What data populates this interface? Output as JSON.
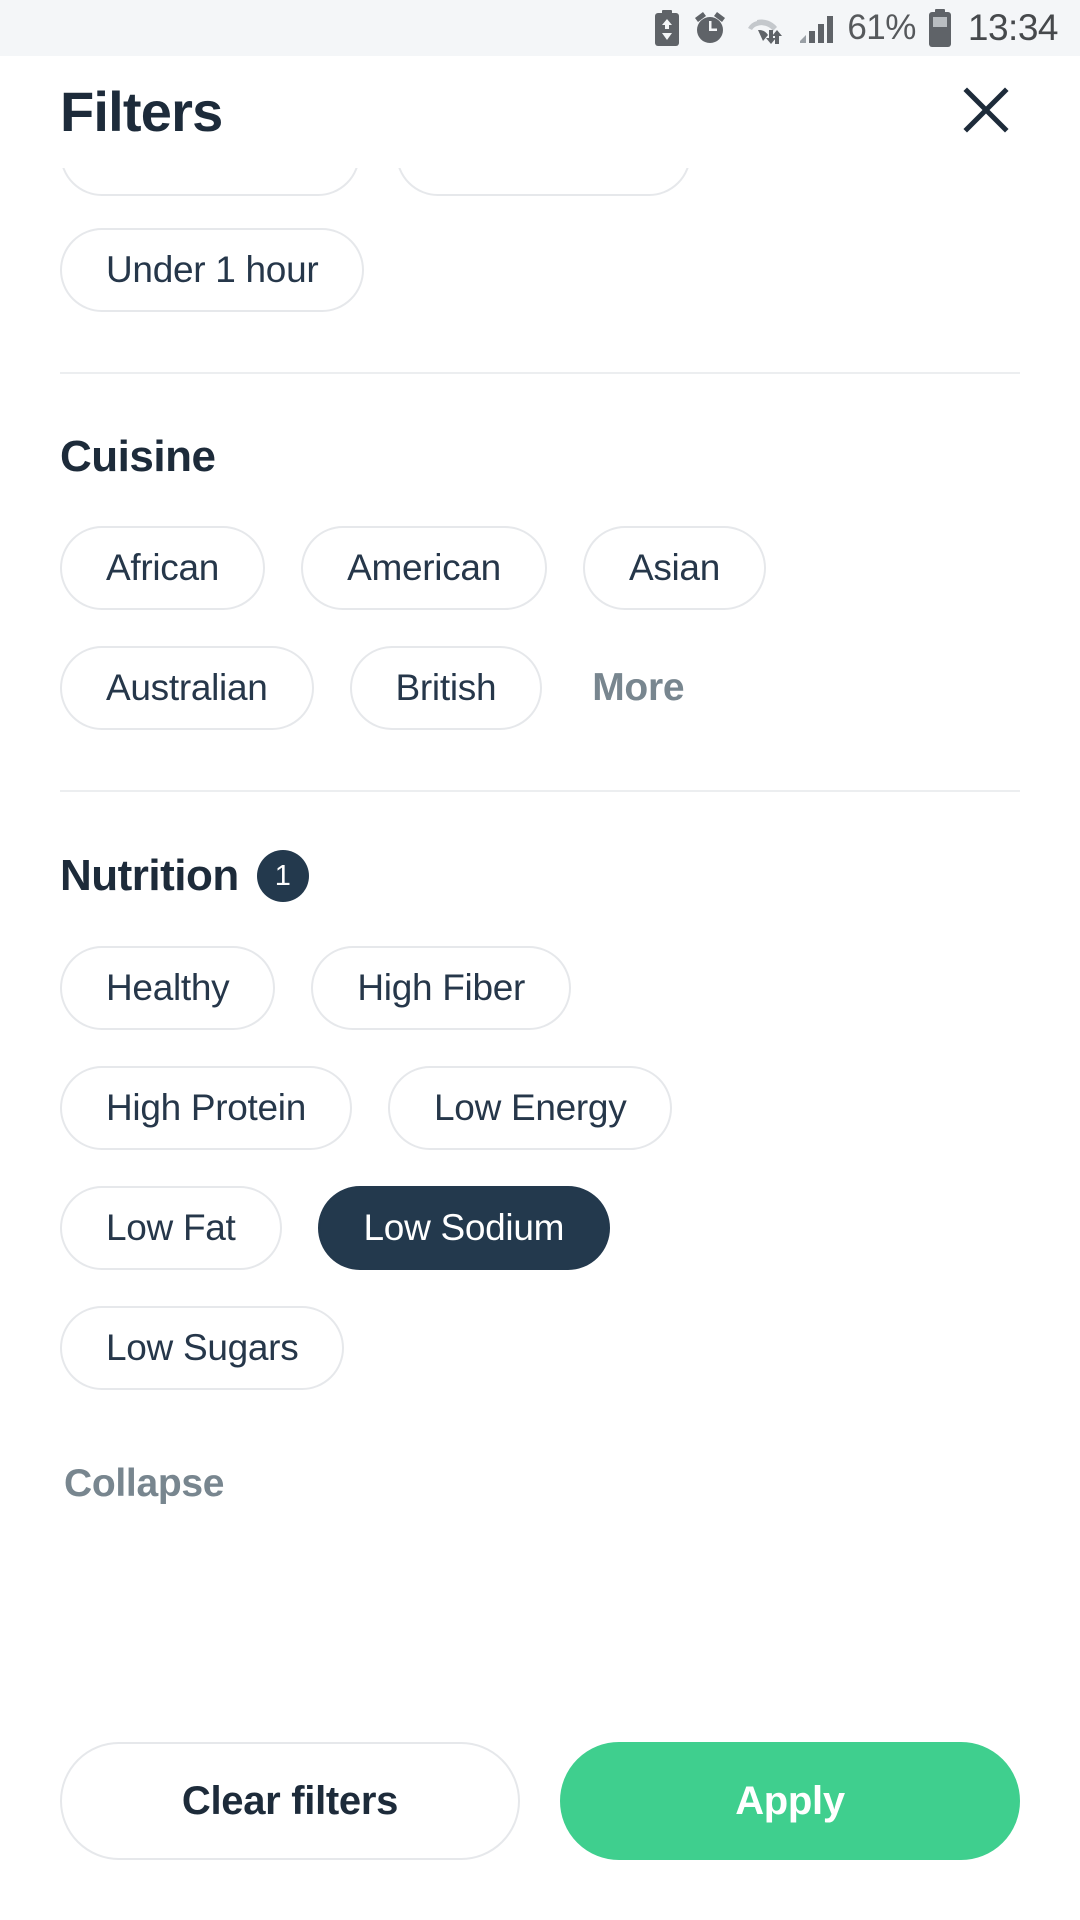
{
  "status_bar": {
    "battery_saver_icon": "battery-saver-icon",
    "alarm_icon": "alarm-clock-icon",
    "wifi_icon": "wifi-data-transfer-icon",
    "signal_icon": "cellular-signal-icon",
    "battery_percent": "61%",
    "battery_icon": "battery-icon",
    "time": "13:34"
  },
  "header": {
    "title": "Filters",
    "close_icon": "close-icon"
  },
  "sections": {
    "time_section": {
      "visible_chips": [
        "Under 1 hour"
      ]
    },
    "cuisine": {
      "title": "Cuisine",
      "chips": [
        "African",
        "American",
        "Asian",
        "Australian",
        "British"
      ],
      "more_label": "More"
    },
    "nutrition": {
      "title": "Nutrition",
      "count": "1",
      "chips": [
        "Healthy",
        "High Fiber",
        "High Protein",
        "Low Energy",
        "Low Fat",
        "Low Sodium",
        "Low Sugars"
      ],
      "selected": [
        "Low Sodium"
      ],
      "collapse_label": "Collapse"
    }
  },
  "footer": {
    "clear_label": "Clear filters",
    "apply_label": "Apply"
  },
  "colors": {
    "accent_green": "#3fcf8e",
    "navy": "#23394d",
    "muted": "#78868f",
    "border": "#e6e8eb",
    "statusbar_bg": "#f4f6f8"
  }
}
